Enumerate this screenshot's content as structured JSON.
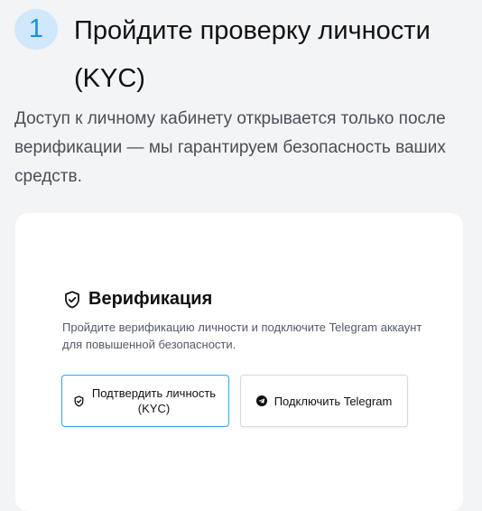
{
  "step": {
    "number": "1",
    "title": "Пройдите проверку личности (KYC)"
  },
  "lead": "Доступ к личному кабинету открывается только после верификации — мы гарантируем безопасность ваших средств.",
  "card": {
    "icon": "shield-check-icon",
    "title": "Верификация",
    "description": "Пройдите верификацию личности и подключите Telegram аккаунт для повышенной безопасности.",
    "buttons": {
      "kyc_label": "Подтвердить личность (KYC)",
      "kyc_icon": "shield-check-icon",
      "telegram_label": "Подключить Telegram",
      "telegram_icon": "telegram-icon"
    }
  },
  "colors": {
    "accent": "#2aa9e8",
    "badge_bg": "#cfe8fb",
    "badge_text": "#1a8ee6",
    "page_bg": "#f3f4f6"
  }
}
